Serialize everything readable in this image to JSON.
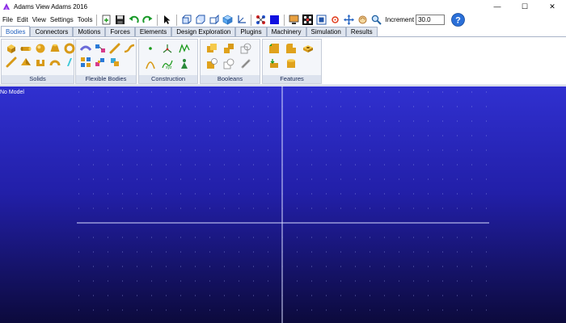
{
  "window": {
    "title": "Adams View Adams 2016",
    "minimize": "—",
    "maximize": "☐",
    "close": "✕"
  },
  "menu": [
    "File",
    "Edit",
    "View",
    "Settings",
    "Tools"
  ],
  "toolbar": {
    "increment_label": "Increment",
    "increment_value": "30.0"
  },
  "tabs": [
    "Bodies",
    "Connectors",
    "Motions",
    "Forces",
    "Elements",
    "Design Exploration",
    "Plugins",
    "Machinery",
    "Simulation",
    "Results"
  ],
  "active_tab": "Bodies",
  "ribbon_groups": [
    {
      "label": "Solids"
    },
    {
      "label": "Flexible Bodies"
    },
    {
      "label": "Construction"
    },
    {
      "label": "Booleans"
    },
    {
      "label": "Features"
    }
  ],
  "viewport": {
    "model_name": "No Model"
  },
  "colors": {
    "accent": "#1f5fbf",
    "viewport_top": "#3030d0",
    "viewport_bottom": "#0c0a3c",
    "solid_gold": "#e0a21c"
  }
}
